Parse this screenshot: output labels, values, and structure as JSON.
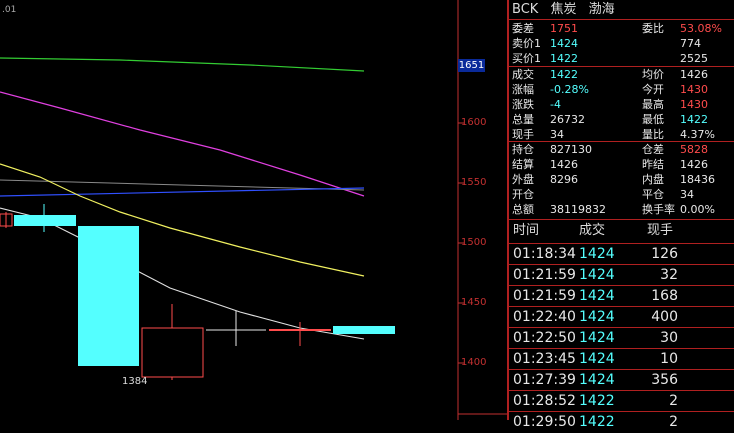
{
  "header": {
    "code": "BCK",
    "name": "焦炭",
    "exchange": "渤海"
  },
  "chart": {
    "corner_label": ".01",
    "current_price_tag": "1651",
    "axis_labels": [
      "1600",
      "1550",
      "1500",
      "1450",
      "1400"
    ],
    "low_label": "1384",
    "colors": {
      "candle_up": "#ff4c4c",
      "candle_down": "#54ffff",
      "ma_green": "#33cc33",
      "ma_magenta": "#e040e0",
      "ma_yellow": "#f0f060",
      "ma_white": "#e0e0e0",
      "ma_blue": "#3050ff",
      "axis": "#c23030"
    }
  },
  "quote": {
    "rows1": [
      {
        "l1": "委差",
        "v1": "1751",
        "c1": "red",
        "l2": "委比",
        "v2": "53.08%",
        "c2": "red"
      },
      {
        "l1": "卖价1",
        "v1": "1424",
        "c1": "cyan",
        "l2": "",
        "v2": "774",
        "c2": "white"
      },
      {
        "l1": "买价1",
        "v1": "1422",
        "c1": "cyan",
        "l2": "",
        "v2": "2525",
        "c2": "white"
      }
    ],
    "rows2": [
      {
        "l1": "成交",
        "v1": "1422",
        "c1": "cyan",
        "l2": "均价",
        "v2": "1426",
        "c2": "white"
      },
      {
        "l1": "涨幅",
        "v1": "-0.28%",
        "c1": "cyan",
        "l2": "今开",
        "v2": "1430",
        "c2": "red"
      },
      {
        "l1": "涨跌",
        "v1": "-4",
        "c1": "cyan",
        "l2": "最高",
        "v2": "1430",
        "c2": "red"
      },
      {
        "l1": "总量",
        "v1": "26732",
        "c1": "white",
        "l2": "最低",
        "v2": "1422",
        "c2": "cyan"
      },
      {
        "l1": "现手",
        "v1": "34",
        "c1": "white",
        "l2": "量比",
        "v2": "4.37%",
        "c2": "white"
      }
    ],
    "rows3": [
      {
        "l1": "持仓",
        "v1": "827130",
        "c1": "white",
        "l2": "仓差",
        "v2": "5828",
        "c2": "red"
      },
      {
        "l1": "结算",
        "v1": "1426",
        "c1": "white",
        "l2": "昨结",
        "v2": "1426",
        "c2": "white"
      },
      {
        "l1": "外盘",
        "v1": "8296",
        "c1": "white",
        "l2": "内盘",
        "v2": "18436",
        "c2": "white"
      },
      {
        "l1": "开仓",
        "v1": "",
        "c1": "white",
        "l2": "平仓",
        "v2": "34",
        "c2": "white"
      },
      {
        "l1": "总额",
        "v1": "38119832",
        "c1": "white",
        "l2": "换手率",
        "v2": "0.00%",
        "c2": "white"
      }
    ]
  },
  "ticks": {
    "headers": {
      "time": "时间",
      "price": "成交",
      "vol": "现手"
    },
    "rows": [
      {
        "time": "01:18:34",
        "price": "1424",
        "vol": "126"
      },
      {
        "time": "01:21:59",
        "price": "1424",
        "vol": "32"
      },
      {
        "time": "01:21:59",
        "price": "1424",
        "vol": "168"
      },
      {
        "time": "01:22:40",
        "price": "1424",
        "vol": "400"
      },
      {
        "time": "01:22:50",
        "price": "1424",
        "vol": "30"
      },
      {
        "time": "01:23:45",
        "price": "1424",
        "vol": "10"
      },
      {
        "time": "01:27:39",
        "price": "1424",
        "vol": "356"
      },
      {
        "time": "01:28:52",
        "price": "1422",
        "vol": "2"
      },
      {
        "time": "01:29:50",
        "price": "1422",
        "vol": "2"
      }
    ]
  }
}
